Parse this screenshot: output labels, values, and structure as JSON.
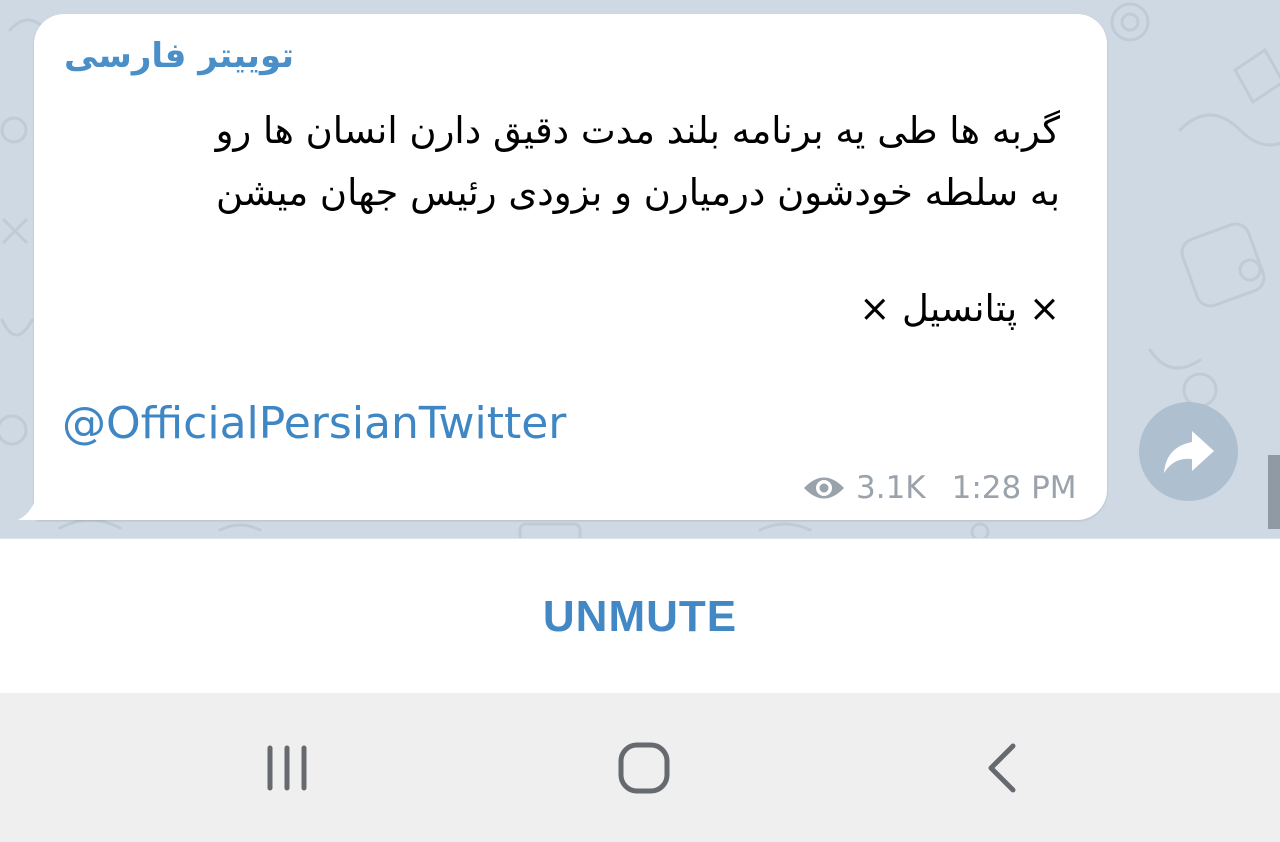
{
  "message": {
    "channel_name": "توییتر فارسی",
    "text_lines": [
      "گربه ها طی یه برنامه بلند مدت دقیق دارن انسان ها رو",
      "به سلطه خودشون درمیارن و بزودی رئیس جهان میشن"
    ],
    "signature": "× پتانسیل ×",
    "mention": "@OfficialPersianTwitter",
    "views": "3.1K",
    "time": "1:28 PM"
  },
  "share": {
    "icon": "share-arrow-icon"
  },
  "bottom_bar": {
    "unmute_label": "UNMUTE"
  },
  "nav_bar": {
    "recents_icon": "recents-icon",
    "home_icon": "home-icon",
    "back_icon": "back-icon"
  },
  "colors": {
    "accent": "#4288c4",
    "channel_name": "#4a8fc8",
    "wallpaper": "#cfd9e3",
    "meta_text": "#9aa3ab",
    "share_button": "#aebfcf",
    "nav_bar": "#efefef"
  }
}
